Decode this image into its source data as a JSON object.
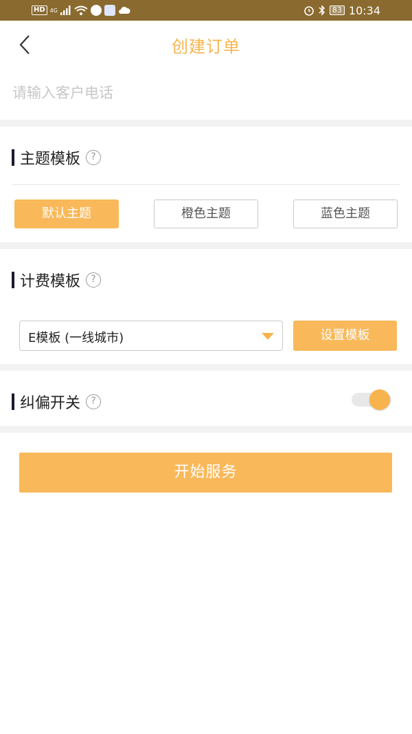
{
  "status_bar": {
    "hd": "HD",
    "network": "4G",
    "battery": "83",
    "time": "10:34"
  },
  "header": {
    "title": "创建订单"
  },
  "phone": {
    "placeholder": "请输入客户电话",
    "value": ""
  },
  "theme_section": {
    "title": "主题模板",
    "help": "?",
    "options": [
      {
        "label": "默认主题",
        "selected": true
      },
      {
        "label": "橙色主题",
        "selected": false
      },
      {
        "label": "蓝色主题",
        "selected": false
      }
    ]
  },
  "billing_section": {
    "title": "计费模板",
    "help": "?",
    "selected_value": "E模板 (一线城市)",
    "set_button": "设置模板"
  },
  "correction_section": {
    "title": "纠偏开关",
    "help": "?",
    "enabled": true
  },
  "start_button": "开始服务",
  "colors": {
    "accent": "#f9b85a",
    "title": "#f7b44e",
    "status_bar": "#8a6a2f"
  }
}
